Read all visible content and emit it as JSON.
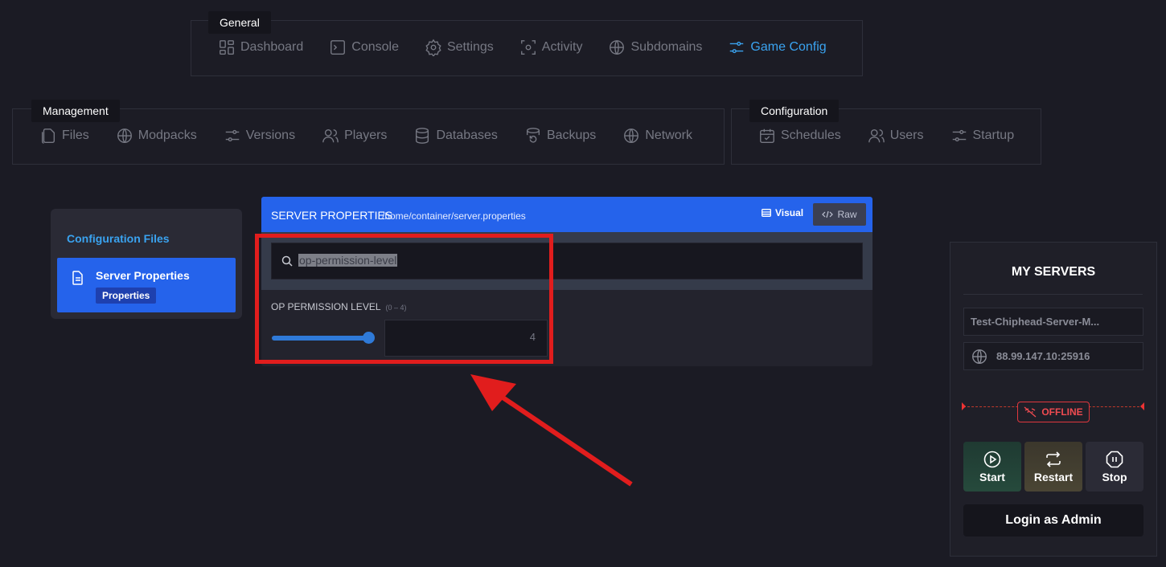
{
  "nav": {
    "general": {
      "label": "General",
      "items": [
        {
          "label": "Dashboard",
          "icon": "dashboard-icon"
        },
        {
          "label": "Console",
          "icon": "console-icon"
        },
        {
          "label": "Settings",
          "icon": "gear-icon"
        },
        {
          "label": "Activity",
          "icon": "activity-icon"
        },
        {
          "label": "Subdomains",
          "icon": "globe-icon"
        },
        {
          "label": "Game Config",
          "icon": "sliders-icon",
          "active": true
        }
      ]
    },
    "management": {
      "label": "Management",
      "items": [
        {
          "label": "Files",
          "icon": "files-icon"
        },
        {
          "label": "Modpacks",
          "icon": "globe-icon"
        },
        {
          "label": "Versions",
          "icon": "sliders-icon"
        },
        {
          "label": "Players",
          "icon": "users-icon"
        },
        {
          "label": "Databases",
          "icon": "database-icon"
        },
        {
          "label": "Backups",
          "icon": "backup-icon"
        },
        {
          "label": "Network",
          "icon": "globe-icon"
        }
      ]
    },
    "configuration": {
      "label": "Configuration",
      "items": [
        {
          "label": "Schedules",
          "icon": "calendar-icon"
        },
        {
          "label": "Users",
          "icon": "users-icon"
        },
        {
          "label": "Startup",
          "icon": "sliders-icon"
        }
      ]
    }
  },
  "sidebar": {
    "title": "Configuration Files",
    "file": {
      "name": "Server Properties",
      "tag": "Properties"
    }
  },
  "editor": {
    "title": "SERVER PROPERTIES",
    "path": "/home/container/server.properties",
    "visual_label": "Visual",
    "raw_label": "Raw",
    "search_value": "op-permission-level",
    "property": {
      "label": "OP PERMISSION LEVEL",
      "range": "(0 – 4)",
      "value": "4",
      "slider_fraction": 1.0
    }
  },
  "servers": {
    "title": "MY SERVERS",
    "name": "Test-Chiphead-Server-M...",
    "address": "88.99.147.10:25916",
    "status": "OFFLINE",
    "status_color": "#f14b51",
    "start_label": "Start",
    "restart_label": "Restart",
    "stop_label": "Stop",
    "login_label": "Login as Admin"
  },
  "colors": {
    "accent": "#3aa3f0",
    "header_blue": "#2563eb",
    "annotation_red": "#e11d1d"
  }
}
